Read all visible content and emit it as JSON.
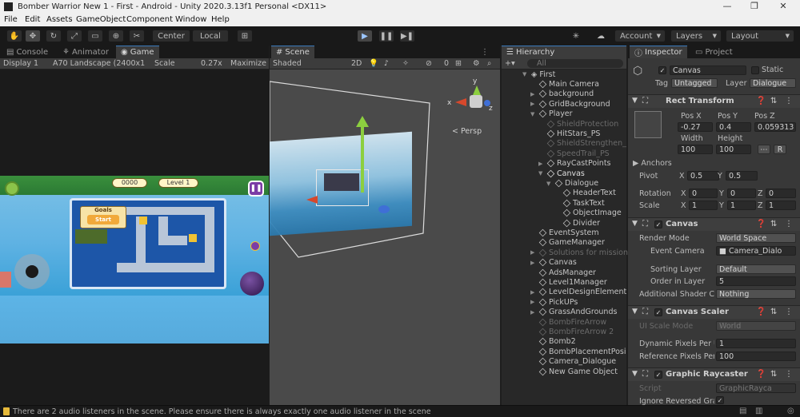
{
  "window": {
    "title": "Bomber Warrior New 1 - First - Android - Unity 2020.3.13f1 Personal <DX11>",
    "minimize": "—",
    "maximize": "❐",
    "close": "✕"
  },
  "menu": [
    "File",
    "Edit",
    "Assets",
    "GameObject",
    "Component",
    "Window",
    "Help"
  ],
  "toolbar": {
    "pivot_label": "Center",
    "space_label": "Local",
    "account_label": "Account",
    "layers_label": "Layers",
    "layout_label": "Layout"
  },
  "game_panel": {
    "tabs": [
      "Console",
      "Animator",
      "Game"
    ],
    "display": "Display 1",
    "resolution": "A70 Landscape (2400x1",
    "scale_label": "Scale",
    "scale_value": "0.27x",
    "maximize": "Maximize",
    "hud": {
      "score": "0000",
      "level": "Level 1",
      "goals_title": "Goals",
      "start_button": "Start"
    }
  },
  "scene_panel": {
    "tab": "Scene",
    "shading": "Shaded",
    "mode_2d": "2D",
    "hidden_count": "0",
    "gizmo_y": "y",
    "gizmo_x": "x",
    "gizmo_z": "z",
    "persp_label": "Persp"
  },
  "hierarchy": {
    "tab": "Hierarchy",
    "search_placeholder": "All",
    "scene_name": "First",
    "items": [
      {
        "name": "Main Camera",
        "indent": 1,
        "expander": "",
        "dim": false
      },
      {
        "name": "background",
        "indent": 1,
        "expander": "▶",
        "dim": false
      },
      {
        "name": "GridBackground",
        "indent": 1,
        "expander": "▶",
        "dim": false
      },
      {
        "name": "Player",
        "indent": 1,
        "expander": "▼",
        "dim": false
      },
      {
        "name": "ShieldProtection",
        "indent": 2,
        "expander": "",
        "dim": true
      },
      {
        "name": "HitStars_PS",
        "indent": 2,
        "expander": "",
        "dim": false
      },
      {
        "name": "ShieldStrengthen_",
        "indent": 2,
        "expander": "",
        "dim": true
      },
      {
        "name": "SpeedTrail_PS",
        "indent": 2,
        "expander": "",
        "dim": true
      },
      {
        "name": "RayCastPoints",
        "indent": 2,
        "expander": "▶",
        "dim": false
      },
      {
        "name": "Canvas",
        "indent": 2,
        "expander": "▼",
        "dim": false,
        "selected": true
      },
      {
        "name": "Dialogue",
        "indent": 3,
        "expander": "▼",
        "dim": false
      },
      {
        "name": "HeaderText",
        "indent": 4,
        "expander": "",
        "dim": false
      },
      {
        "name": "TaskText",
        "indent": 4,
        "expander": "",
        "dim": false
      },
      {
        "name": "ObjectImage",
        "indent": 4,
        "expander": "",
        "dim": false
      },
      {
        "name": "Divider",
        "indent": 4,
        "expander": "",
        "dim": false
      },
      {
        "name": "EventSystem",
        "indent": 1,
        "expander": "",
        "dim": false
      },
      {
        "name": "GameManager",
        "indent": 1,
        "expander": "",
        "dim": false
      },
      {
        "name": "Solutions for mission",
        "indent": 1,
        "expander": "▶",
        "dim": true
      },
      {
        "name": "Canvas",
        "indent": 1,
        "expander": "▶",
        "dim": false
      },
      {
        "name": "AdsManager",
        "indent": 1,
        "expander": "",
        "dim": false
      },
      {
        "name": "Level1Manager",
        "indent": 1,
        "expander": "",
        "dim": false
      },
      {
        "name": "LevelDesignElement",
        "indent": 1,
        "expander": "▶",
        "dim": false
      },
      {
        "name": "PickUPs",
        "indent": 1,
        "expander": "▶",
        "dim": false
      },
      {
        "name": "GrassAndGrounds",
        "indent": 1,
        "expander": "▶",
        "dim": false
      },
      {
        "name": "BombFireArrow",
        "indent": 1,
        "expander": "",
        "dim": true
      },
      {
        "name": "BombFireArrow 2",
        "indent": 1,
        "expander": "",
        "dim": true
      },
      {
        "name": "Bomb2",
        "indent": 1,
        "expander": "",
        "dim": false
      },
      {
        "name": "BombPlacementPosi",
        "indent": 1,
        "expander": "",
        "dim": false
      },
      {
        "name": "Camera_Dialogue",
        "indent": 1,
        "expander": "",
        "dim": false
      },
      {
        "name": "New Game Object",
        "indent": 1,
        "expander": "",
        "dim": false
      }
    ]
  },
  "inspector": {
    "tabs": [
      "Inspector",
      "Project"
    ],
    "object_name": "Canvas",
    "static_label": "Static",
    "tag_label": "Tag",
    "tag_value": "Untagged",
    "layer_label": "Layer",
    "layer_value": "Dialogue",
    "rect_transform": {
      "title": "Rect Transform",
      "pos_x_label": "Pos X",
      "pos_y_label": "Pos Y",
      "pos_z_label": "Pos Z",
      "pos_x": "-0.27",
      "pos_y": "0.4",
      "pos_z": "0.059313",
      "width_label": "Width",
      "height_label": "Height",
      "width": "100",
      "height": "100",
      "raw_button": "R",
      "anchors_label": "Anchors",
      "pivot_label": "Pivot",
      "pivot_x": "0.5",
      "pivot_y": "0.5",
      "rotation_label": "Rotation",
      "rot_x": "0",
      "rot_y": "0",
      "rot_z": "0",
      "scale_label": "Scale",
      "scale_x": "1",
      "scale_y": "1",
      "scale_z": "1"
    },
    "canvas": {
      "title": "Canvas",
      "render_mode_label": "Render Mode",
      "render_mode": "World Space",
      "event_camera_label": "Event Camera",
      "event_camera": "Camera_Dialo",
      "sorting_layer_label": "Sorting Layer",
      "sorting_layer": "Default",
      "order_in_layer_label": "Order in Layer",
      "order_in_layer": "5",
      "shader_channels_label": "Additional Shader Ch",
      "shader_channels": "Nothing"
    },
    "canvas_scaler": {
      "title": "Canvas Scaler",
      "ui_scale_mode_label": "UI Scale Mode",
      "ui_scale_mode": "World",
      "dynamic_ppu_label": "Dynamic Pixels Per U",
      "dynamic_ppu": "1",
      "reference_ppu_label": "Reference Pixels Per",
      "reference_ppu": "100"
    },
    "graphic_raycaster": {
      "title": "Graphic Raycaster",
      "script_label": "Script",
      "script_value": "GraphicRayca",
      "ignore_reversed_label": "Ignore Reversed Gra",
      "ignore_reversed_value": "✓"
    }
  },
  "statusbar": {
    "message": "There are 2 audio listeners in the scene. Please ensure there is always exactly one audio listener in the scene"
  },
  "colors": {
    "accent": "#3a79bb",
    "warning": "#e6b93a",
    "gizmo_x": "#d6482c",
    "gizmo_y": "#8ccf3f",
    "gizmo_z": "#3f6fd6"
  }
}
